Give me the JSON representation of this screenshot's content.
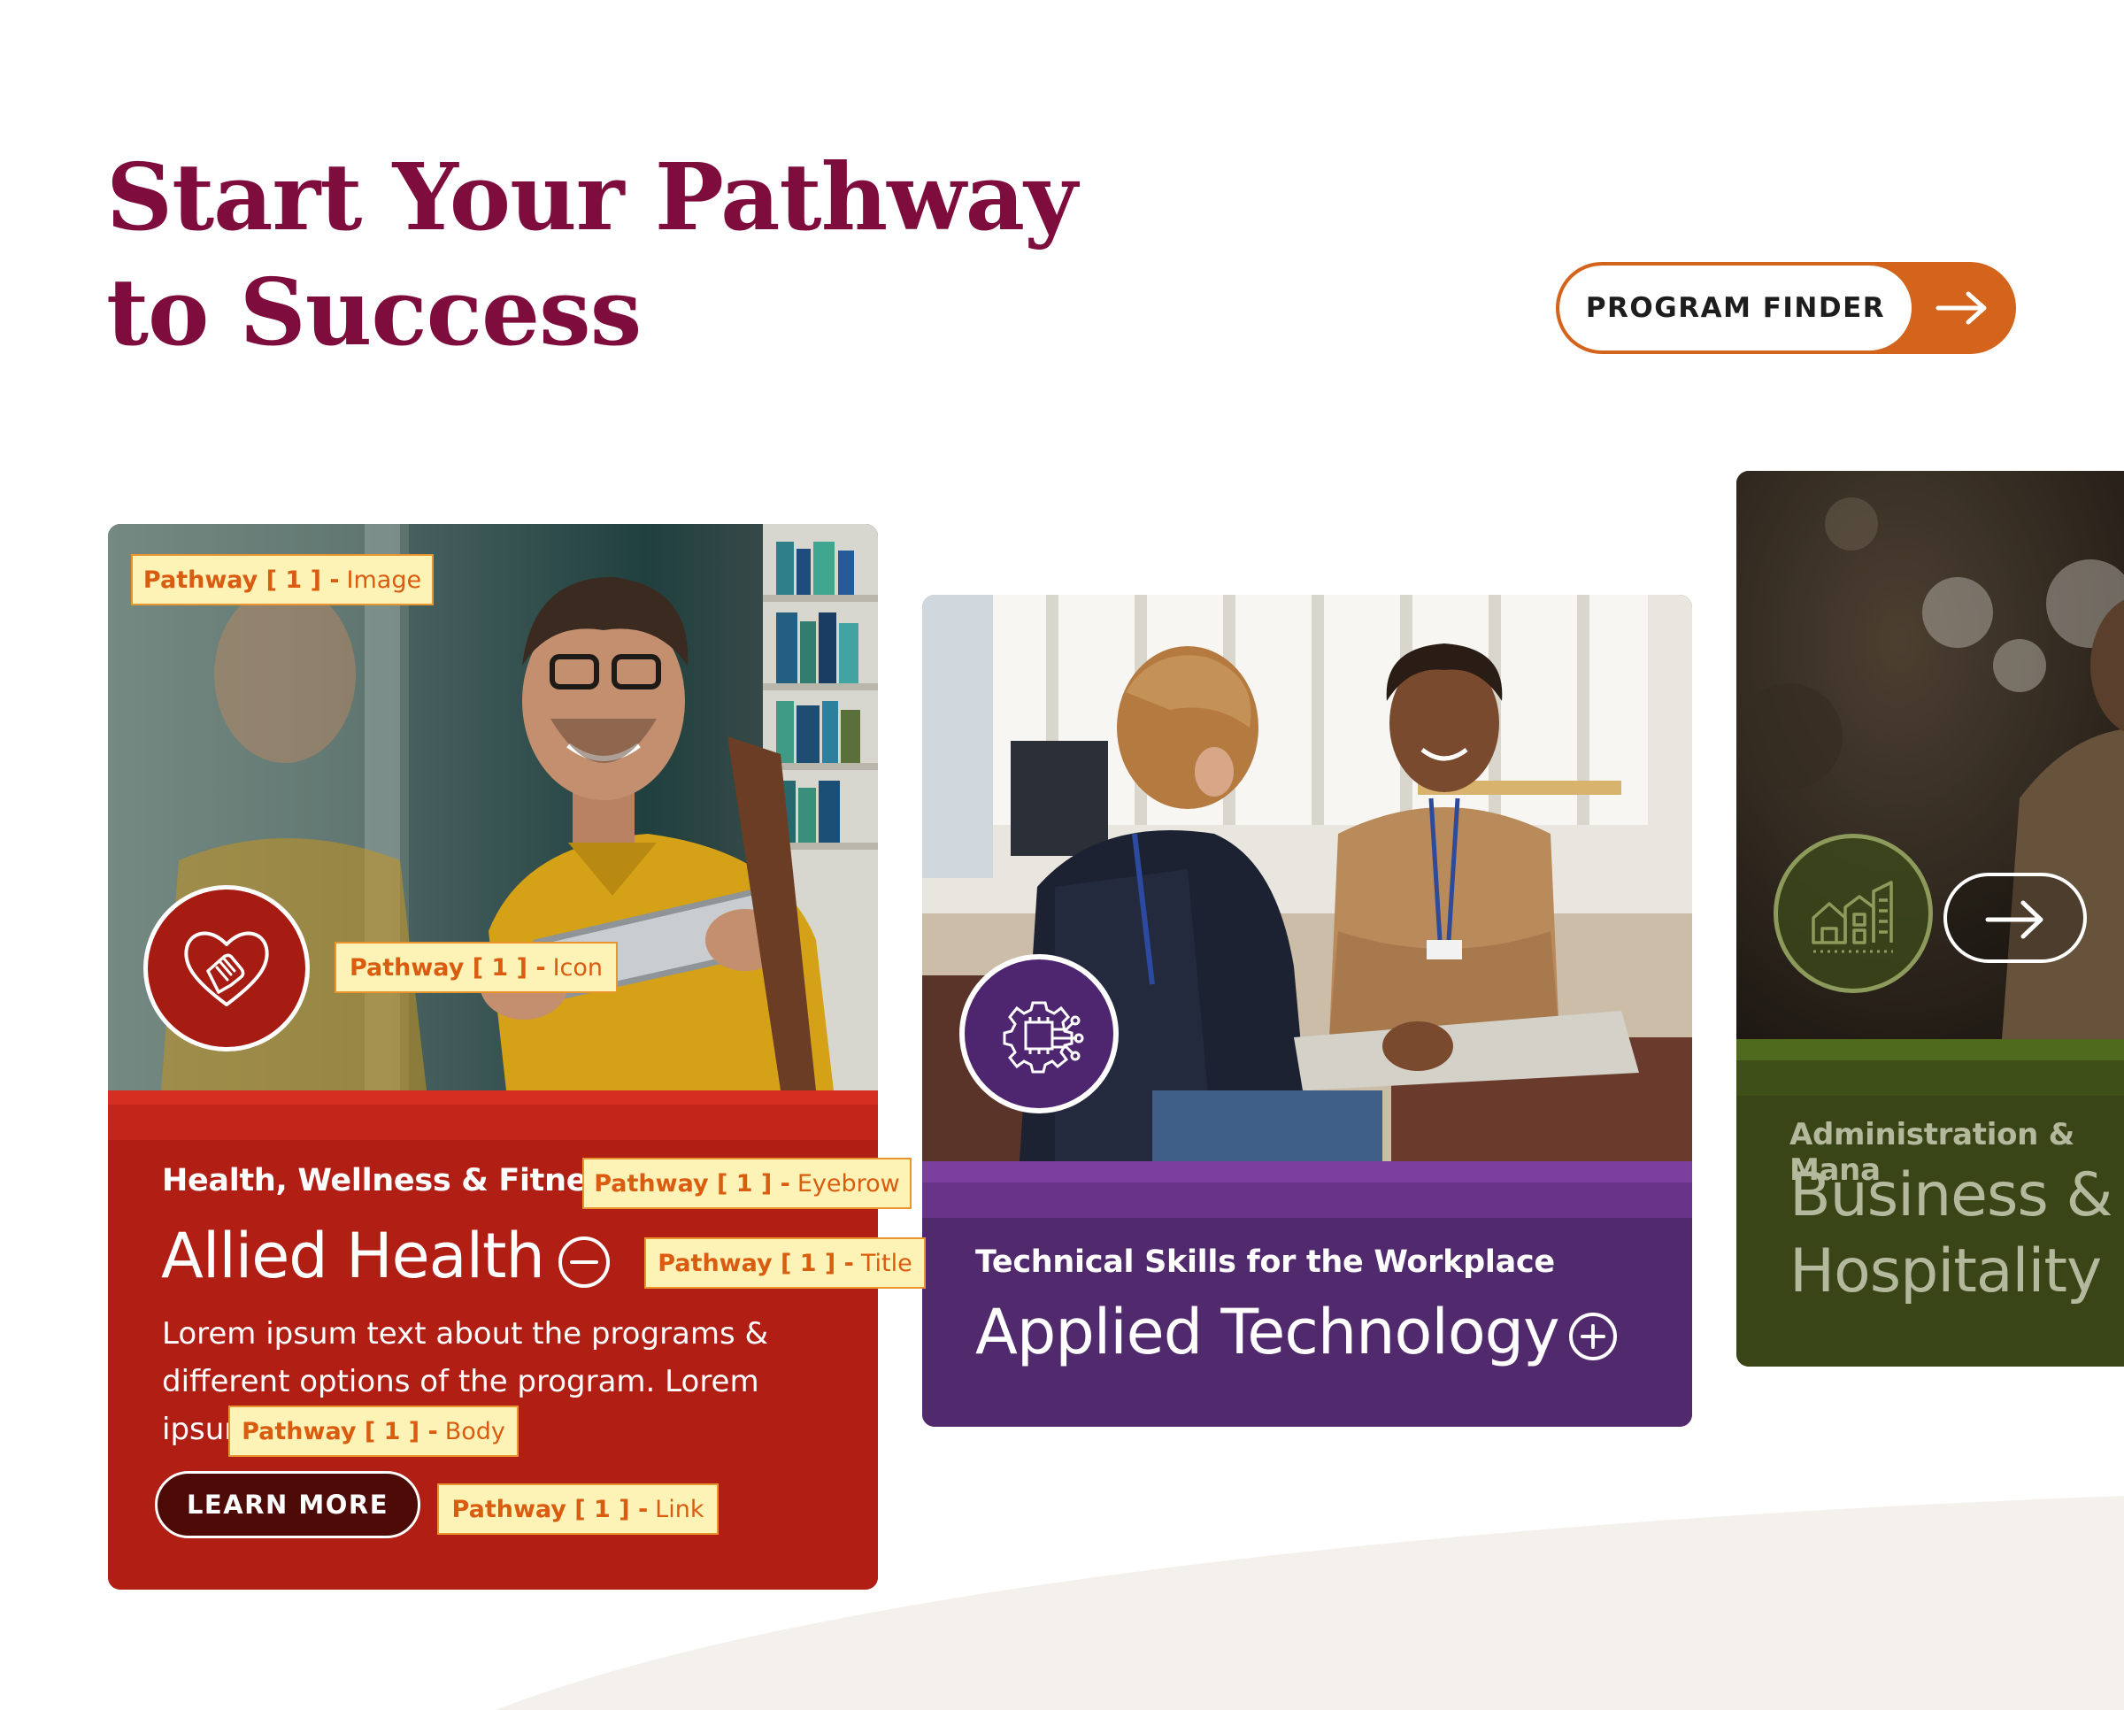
{
  "header": {
    "title_line1": "Start Your Pathway",
    "title_line2": "to Success",
    "program_finder_label": "PROGRAM FINDER"
  },
  "colors": {
    "brand_maroon": "#7e0d3e",
    "accent_orange": "#d4641b",
    "health_red": "#b01e14",
    "technology_purple": "#512a6e",
    "business_green": "#394516",
    "annotation_fill": "#fdf3b6",
    "annotation_text": "#d95c10"
  },
  "pathways": [
    {
      "eyebrow": "Health, Wellness & Fitness",
      "title": "Allied Health",
      "body": "Lorem ipsum text about the programs & different options of the program. Lorem ipsum text",
      "link_label": "LEARN MORE",
      "icon": "heart-hand-icon",
      "toggle_icon": "minus-circle-icon",
      "expanded": true
    },
    {
      "eyebrow": "Technical Skills for the Workplace",
      "title": "Applied Technology",
      "icon": "circuit-chip-icon",
      "toggle_icon": "plus-circle-icon",
      "expanded": false
    },
    {
      "eyebrow": "Administration & Mana",
      "title_line1": "Business &",
      "title_line2": "Hospitality",
      "icon": "buildings-icon"
    }
  ],
  "annotations": {
    "image": {
      "prefix": "Pathway [ 1 ] -",
      "label": "Image"
    },
    "icon": {
      "prefix": "Pathway [ 1 ] -",
      "label": "Icon"
    },
    "eyebrow": {
      "prefix": "Pathway [ 1 ] -",
      "label": "Eyebrow"
    },
    "title": {
      "prefix": "Pathway [ 1 ] -",
      "label": "Title"
    },
    "body": {
      "prefix": "Pathway [ 1 ] -",
      "label": "Body"
    },
    "link": {
      "prefix": "Pathway [ 1 ] -",
      "label": "Link"
    }
  }
}
